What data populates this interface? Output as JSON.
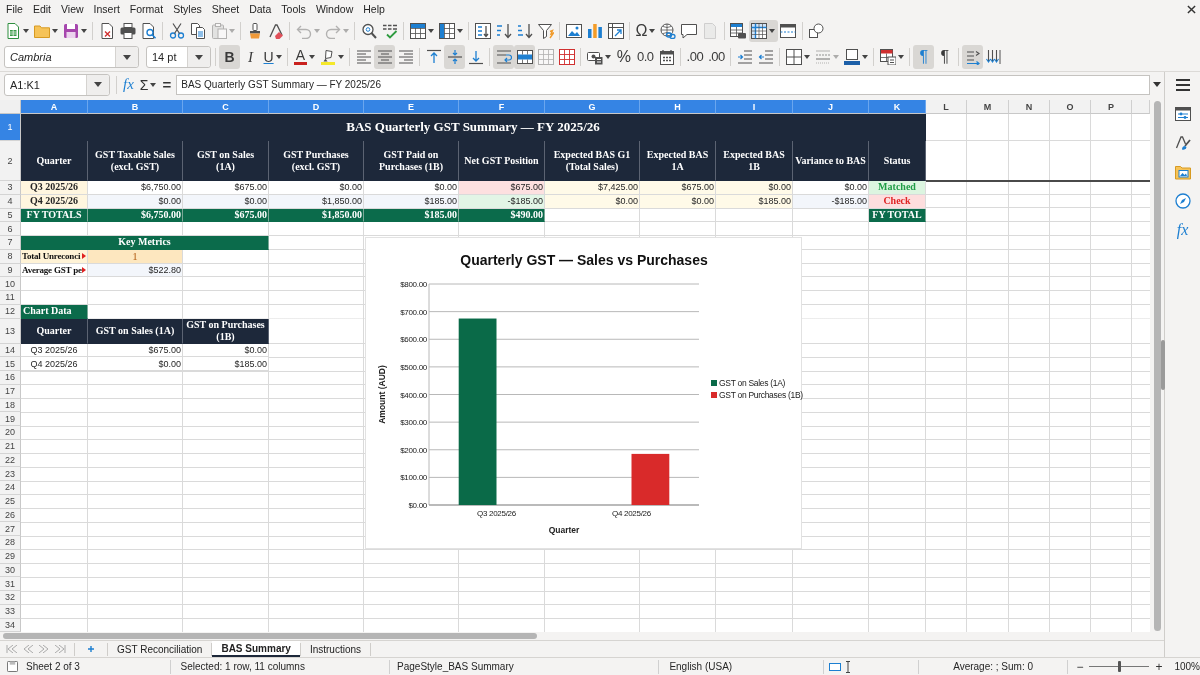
{
  "menu_bar": {
    "items": [
      "File",
      "Edit",
      "View",
      "Insert",
      "Format",
      "Styles",
      "Sheet",
      "Data",
      "Tools",
      "Window",
      "Help"
    ]
  },
  "standard_toolbar": {
    "groups": [
      [
        {
          "kind": "new",
          "dropdown": true,
          "pressed": false,
          "disabled": false
        },
        {
          "kind": "open",
          "dropdown": true,
          "pressed": false,
          "disabled": false
        },
        {
          "kind": "save",
          "dropdown": true,
          "pressed": false,
          "disabled": false
        }
      ],
      [
        {
          "kind": "export_pdf",
          "pressed": false,
          "disabled": false
        },
        {
          "kind": "print",
          "pressed": false,
          "disabled": false
        },
        {
          "kind": "preview",
          "pressed": false,
          "disabled": false
        }
      ],
      [
        {
          "kind": "cut",
          "pressed": false,
          "disabled": false
        },
        {
          "kind": "copy",
          "pressed": false,
          "disabled": false
        },
        {
          "kind": "paste",
          "dropdown": true,
          "pressed": false,
          "disabled": true
        }
      ],
      [
        {
          "kind": "clone",
          "pressed": false,
          "disabled": false
        },
        {
          "kind": "clear",
          "pressed": false,
          "disabled": false
        }
      ],
      [
        {
          "kind": "undo",
          "dropdown": true,
          "pressed": false,
          "disabled": true
        },
        {
          "kind": "redo",
          "dropdown": true,
          "pressed": false,
          "disabled": true
        }
      ],
      [
        {
          "kind": "find",
          "pressed": false,
          "disabled": false
        },
        {
          "kind": "spelling",
          "pressed": false,
          "disabled": false
        }
      ],
      [
        {
          "kind": "row",
          "dropdown": true,
          "pressed": false,
          "disabled": false
        },
        {
          "kind": "column",
          "dropdown": true,
          "pressed": false,
          "disabled": false
        }
      ],
      [
        {
          "kind": "sort",
          "pressed": false,
          "disabled": false
        },
        {
          "kind": "sort_asc",
          "pressed": false,
          "disabled": false
        },
        {
          "kind": "sort_desc",
          "pressed": false,
          "disabled": false
        },
        {
          "kind": "autofilter",
          "pressed": false,
          "disabled": false
        }
      ],
      [
        {
          "kind": "image",
          "pressed": false,
          "disabled": false
        },
        {
          "kind": "chart",
          "pressed": false,
          "disabled": false
        },
        {
          "kind": "pivot",
          "pressed": false,
          "disabled": false
        }
      ],
      [
        {
          "kind": "special_char",
          "label": "Ω",
          "dropdown": true,
          "pressed": false,
          "disabled": false
        },
        {
          "kind": "hyperlink",
          "pressed": false,
          "disabled": false
        },
        {
          "kind": "comment",
          "pressed": false,
          "disabled": false
        },
        {
          "kind": "header_footer",
          "pressed": false,
          "disabled": true
        }
      ],
      [
        {
          "kind": "print_area",
          "pressed": false,
          "disabled": false
        },
        {
          "kind": "freeze",
          "dropdown": true,
          "pressed": true,
          "disabled": false
        },
        {
          "kind": "split",
          "pressed": false,
          "disabled": false
        }
      ],
      [
        {
          "kind": "draw",
          "pressed": false,
          "disabled": false
        }
      ]
    ]
  },
  "formatting_toolbar": {
    "font_name": "Cambria",
    "font_size": "14 pt",
    "groups": [
      [
        {
          "kind": "bold",
          "label": "B",
          "pressed": true,
          "disabled": false
        },
        {
          "kind": "italic",
          "label": "I",
          "pressed": false,
          "disabled": false
        },
        {
          "kind": "underline",
          "label": "U",
          "dropdown": true,
          "pressed": false,
          "disabled": false
        }
      ],
      [
        {
          "kind": "font_color",
          "label": "A",
          "dropdown": true,
          "pressed": false,
          "disabled": false
        },
        {
          "kind": "highlight",
          "dropdown": true,
          "pressed": false,
          "disabled": false
        }
      ],
      [
        {
          "kind": "align_left",
          "pressed": false,
          "disabled": false
        },
        {
          "kind": "align_center",
          "pressed": true,
          "disabled": false
        },
        {
          "kind": "align_right",
          "pressed": false,
          "disabled": false
        }
      ],
      [
        {
          "kind": "align_top",
          "pressed": false,
          "disabled": false
        },
        {
          "kind": "align_middle",
          "pressed": true,
          "disabled": false
        },
        {
          "kind": "align_bottom",
          "pressed": false,
          "disabled": false
        }
      ],
      [
        {
          "kind": "wrap",
          "pressed": true,
          "disabled": false
        },
        {
          "kind": "merge_center",
          "pressed": true,
          "disabled": false
        },
        {
          "kind": "merge",
          "pressed": false,
          "disabled": true
        },
        {
          "kind": "unmerge",
          "pressed": false,
          "disabled": false
        }
      ],
      [
        {
          "kind": "currency",
          "dropdown": true,
          "pressed": false,
          "disabled": false
        },
        {
          "kind": "percent",
          "label": "%",
          "pressed": false,
          "disabled": false
        },
        {
          "kind": "number",
          "label": "0.0",
          "pressed": false,
          "disabled": false
        },
        {
          "kind": "date",
          "pressed": false,
          "disabled": false
        }
      ],
      [
        {
          "kind": "add_decimal",
          "label": ".00",
          "pressed": false,
          "disabled": false
        },
        {
          "kind": "delete_decimal",
          "label": ".00",
          "pressed": false,
          "disabled": false
        }
      ],
      [
        {
          "kind": "indent_inc",
          "pressed": false,
          "disabled": false
        },
        {
          "kind": "indent_dec",
          "pressed": false,
          "disabled": false
        }
      ],
      [
        {
          "kind": "borders",
          "dropdown": true,
          "pressed": false,
          "disabled": false
        },
        {
          "kind": "border_style",
          "dropdown": true,
          "pressed": false,
          "disabled": true
        },
        {
          "kind": "border_color",
          "dropdown": true,
          "pressed": false,
          "disabled": false
        }
      ],
      [
        {
          "kind": "conditional",
          "dropdown": true,
          "pressed": false,
          "disabled": false
        }
      ],
      [
        {
          "kind": "ltr",
          "label": "¶",
          "pressed": true,
          "disabled": false
        },
        {
          "kind": "rtl",
          "label": "¶",
          "pressed": false,
          "disabled": false
        }
      ],
      [
        {
          "kind": "text_ltr",
          "pressed": true,
          "disabled": false
        },
        {
          "kind": "text_ttb",
          "pressed": false,
          "disabled": false
        }
      ]
    ]
  },
  "formula_bar": {
    "name_box": "A1:K1",
    "function_wizard": "fx",
    "sum": "Σ",
    "equals": "=",
    "content": "BAS Quarterly GST Summary — FY 2025/26"
  },
  "sidebar": {
    "functions": "fx"
  },
  "sheet": {
    "columns": [
      {
        "label": "A",
        "selected": true
      },
      {
        "label": "B",
        "selected": true
      },
      {
        "label": "C",
        "selected": true
      },
      {
        "label": "D",
        "selected": true
      },
      {
        "label": "E",
        "selected": true
      },
      {
        "label": "F",
        "selected": true
      },
      {
        "label": "G",
        "selected": true
      },
      {
        "label": "H",
        "selected": true
      },
      {
        "label": "I",
        "selected": true
      },
      {
        "label": "J",
        "selected": true
      },
      {
        "label": "K",
        "selected": true
      },
      {
        "label": "L",
        "selected": false
      },
      {
        "label": "M",
        "selected": false
      },
      {
        "label": "N",
        "selected": false
      },
      {
        "label": "O",
        "selected": false
      },
      {
        "label": "P",
        "selected": false
      }
    ],
    "rows": [
      {
        "label": "1",
        "selected": true,
        "cells": [
          {
            "kind": "title",
            "text": "BAS Quarterly GST Summary — FY 2025/26"
          }
        ]
      },
      {
        "label": "2",
        "selected": false,
        "cells": [
          {
            "kind": "header",
            "text": "Quarter"
          },
          {
            "kind": "header",
            "text": "GST Taxable Sales\n(excl. GST)"
          },
          {
            "kind": "header",
            "text": "GST on Sales\n(1A)"
          },
          {
            "kind": "header",
            "text": "GST Purchases\n(excl. GST)"
          },
          {
            "kind": "header",
            "text": "GST Paid on\nPurchases (1B)"
          },
          {
            "kind": "header",
            "text": "Net GST Position"
          },
          {
            "kind": "header",
            "text": "Expected BAS G1\n(Total Sales)"
          },
          {
            "kind": "header",
            "text": "Expected BAS\n1A"
          },
          {
            "kind": "header",
            "text": "Expected BAS\n1B"
          },
          {
            "kind": "header",
            "text": "Variance to BAS"
          },
          {
            "kind": "header",
            "text": "Status"
          }
        ]
      },
      {
        "label": "3",
        "selected": false,
        "cells": [
          {
            "kind": "quarter",
            "text": "Q3 2025/26"
          },
          {
            "kind": "amount",
            "text": "$6,750.00"
          },
          {
            "kind": "amount",
            "text": "$675.00"
          },
          {
            "kind": "amount",
            "text": "$0.00"
          },
          {
            "kind": "amount",
            "text": "$0.00"
          },
          {
            "kind": "amount_over",
            "text": "$675.00"
          },
          {
            "kind": "amount_warm",
            "text": "$7,425.00"
          },
          {
            "kind": "amount_warm",
            "text": "$675.00"
          },
          {
            "kind": "amount_warm",
            "text": "$0.00"
          },
          {
            "kind": "amount",
            "text": "$0.00"
          },
          {
            "kind": "status_ok",
            "text": "Matched"
          }
        ]
      },
      {
        "label": "4",
        "selected": false,
        "cells": [
          {
            "kind": "quarter",
            "text": "Q4 2025/26"
          },
          {
            "kind": "amount_banded",
            "text": "$0.00"
          },
          {
            "kind": "amount_banded",
            "text": "$0.00"
          },
          {
            "kind": "amount_banded",
            "text": "$1,850.00"
          },
          {
            "kind": "amount_banded",
            "text": "$185.00"
          },
          {
            "kind": "amount_under",
            "text": "-$185.00"
          },
          {
            "kind": "amount_warm",
            "text": "$0.00"
          },
          {
            "kind": "amount_warm",
            "text": "$0.00"
          },
          {
            "kind": "amount_warm",
            "text": "$185.00"
          },
          {
            "kind": "amount_banded",
            "text": "-$185.00"
          },
          {
            "kind": "status_alert",
            "text": "Check"
          }
        ]
      },
      {
        "label": "5",
        "selected": false,
        "cells": [
          {
            "kind": "total_label",
            "text": "FY TOTALS"
          },
          {
            "kind": "total",
            "text": "$6,750.00"
          },
          {
            "kind": "total",
            "text": "$675.00"
          },
          {
            "kind": "total",
            "text": "$1,850.00"
          },
          {
            "kind": "total",
            "text": "$185.00"
          },
          {
            "kind": "total",
            "text": "$490.00"
          },
          {
            "kind": "blank"
          },
          {
            "kind": "blank"
          },
          {
            "kind": "blank"
          },
          {
            "kind": "blank"
          },
          {
            "kind": "total_label",
            "text": "FY TOTAL"
          }
        ]
      },
      {
        "label": "6",
        "selected": false
      },
      {
        "label": "7",
        "selected": false,
        "cells": [
          {
            "kind": "section",
            "text": "Key Metrics"
          }
        ]
      },
      {
        "label": "8",
        "selected": false,
        "cells": [
          {
            "kind": "label_warm",
            "text": "Total Unreconci",
            "clipped": true
          },
          {
            "kind": "metric_count",
            "text": "1"
          }
        ]
      },
      {
        "label": "9",
        "selected": false,
        "cells": [
          {
            "kind": "label",
            "text": "Average GST pe",
            "clipped": true
          },
          {
            "kind": "amount_banded",
            "text": "$522.80"
          }
        ]
      },
      {
        "label": "10",
        "selected": false
      },
      {
        "label": "11",
        "selected": false
      },
      {
        "label": "12",
        "selected": false,
        "cells": [
          {
            "kind": "chart_label",
            "text": "Chart Data"
          }
        ]
      },
      {
        "label": "13",
        "selected": false,
        "cells": [
          {
            "kind": "header",
            "text": "Quarter"
          },
          {
            "kind": "header",
            "text": "GST on Sales (1A)"
          },
          {
            "kind": "header",
            "text": "GST on Purchases\n(1B)"
          }
        ]
      },
      {
        "label": "14",
        "selected": false,
        "cells": [
          {
            "kind": "plain",
            "text": "Q3 2025/26"
          },
          {
            "kind": "amount",
            "text": "$675.00"
          },
          {
            "kind": "amount",
            "text": "$0.00"
          }
        ]
      },
      {
        "label": "15",
        "selected": false,
        "cells": [
          {
            "kind": "plain",
            "text": "Q4 2025/26"
          },
          {
            "kind": "amount",
            "text": "$0.00"
          },
          {
            "kind": "amount",
            "text": "$185.00"
          }
        ]
      },
      {
        "label": "16",
        "selected": false
      },
      {
        "label": "17",
        "selected": false
      },
      {
        "label": "18",
        "selected": false
      },
      {
        "label": "19",
        "selected": false
      },
      {
        "label": "20",
        "selected": false
      },
      {
        "label": "21",
        "selected": false
      },
      {
        "label": "22",
        "selected": false
      },
      {
        "label": "23",
        "selected": false
      },
      {
        "label": "24",
        "selected": false
      },
      {
        "label": "25",
        "selected": false
      },
      {
        "label": "26",
        "selected": false
      },
      {
        "label": "27",
        "selected": false
      },
      {
        "label": "28",
        "selected": false
      },
      {
        "label": "29",
        "selected": false
      },
      {
        "label": "30",
        "selected": false
      },
      {
        "label": "31",
        "selected": false
      },
      {
        "label": "32",
        "selected": false
      },
      {
        "label": "33",
        "selected": false
      },
      {
        "label": "34",
        "selected": false
      }
    ],
    "chart_data": {
      "type": "bar",
      "title": "Quarterly GST — Sales vs Purchases",
      "xlabel": "Quarter",
      "ylabel": "Amount (AUD)",
      "categories": [
        "Q3 2025/26",
        "Q4 2025/26"
      ],
      "series": [
        {
          "name": "GST on Sales (1A)",
          "color": "#0a6a48",
          "values": [
            675,
            0
          ]
        },
        {
          "name": "GST on Purchases (1B)",
          "color": "#d92a2a",
          "values": [
            0,
            185
          ]
        }
      ],
      "ylim": [
        0,
        800
      ],
      "yticks": [
        {
          "value": 0,
          "label": "$0.00"
        },
        {
          "value": 100,
          "label": "$100.00"
        },
        {
          "value": 200,
          "label": "$200.00"
        },
        {
          "value": 300,
          "label": "$300.00"
        },
        {
          "value": 400,
          "label": "$400.00"
        },
        {
          "value": 500,
          "label": "$500.00"
        },
        {
          "value": 600,
          "label": "$600.00"
        },
        {
          "value": 700,
          "label": "$700.00"
        },
        {
          "value": 800,
          "label": "$800.00"
        }
      ],
      "grid": true,
      "legend": "right"
    }
  },
  "sheet_tabs": {
    "tabs": [
      {
        "label": "GST Reconciliation",
        "selected": false
      },
      {
        "label": "BAS Summary",
        "selected": true
      },
      {
        "label": "Instructions",
        "selected": false
      }
    ]
  },
  "status_bar": {
    "sheet": "Sheet 2 of 3",
    "selection": "Selected: 1 row, 11 columns",
    "page_style": "PageStyle_BAS Summary",
    "language": "English (USA)",
    "summary": "Average: ; Sum: 0",
    "zoom": {
      "minus": "−",
      "plus": "+",
      "level": 0.5,
      "value": "100%"
    }
  }
}
